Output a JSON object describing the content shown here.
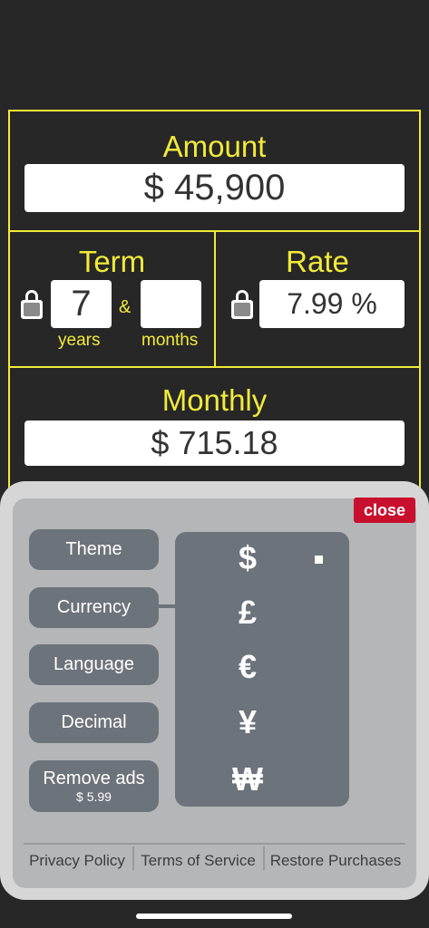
{
  "calculator": {
    "amount_label": "Amount",
    "amount_value": "$ 45,900",
    "term_label": "Term",
    "term_years_value": "7",
    "term_months_value": "",
    "term_amp": "&",
    "years_label": "years",
    "months_label": "months",
    "rate_label": "Rate",
    "rate_value": "7.99 %",
    "monthly_label": "Monthly",
    "monthly_value": "$ 715.18"
  },
  "settings": {
    "close_label": "close",
    "menu": [
      {
        "label": "Theme"
      },
      {
        "label": "Currency"
      },
      {
        "label": "Language"
      },
      {
        "label": "Decimal"
      },
      {
        "label": "Remove ads",
        "price": "$ 5.99"
      }
    ],
    "currencies": [
      "$",
      "£",
      "€",
      "¥",
      "₩"
    ],
    "selected_currency": "$",
    "footer": {
      "privacy": "Privacy Policy",
      "terms": "Terms of Service",
      "restore": "Restore Purchases"
    }
  },
  "colors": {
    "accent": "#f2ea3a",
    "background": "#272727",
    "close": "#c8102e",
    "button": "#6d737b"
  }
}
